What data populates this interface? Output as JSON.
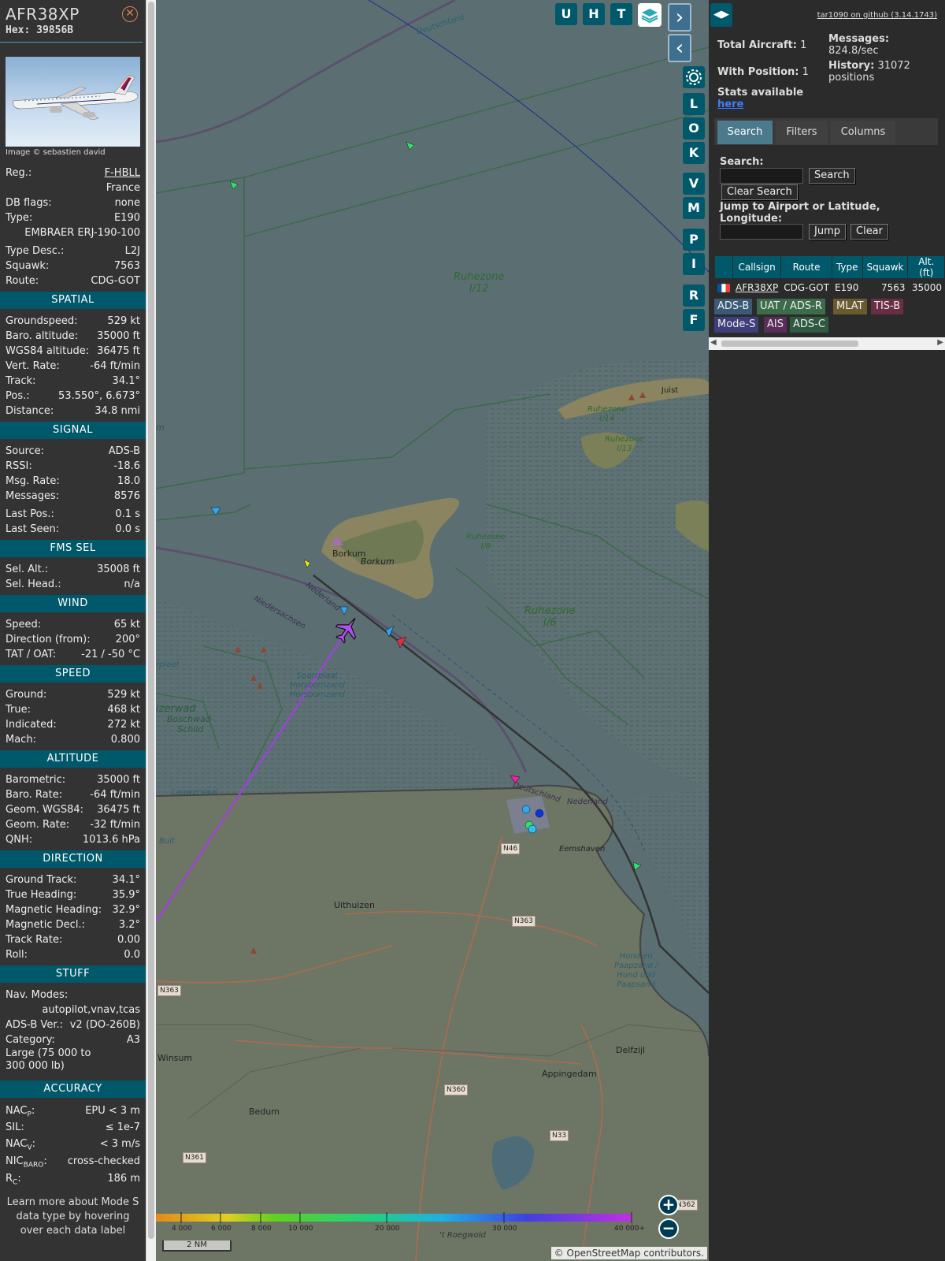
{
  "aircraft": {
    "callsign": "AFR38XP",
    "hex_label": "Hex:",
    "hex_value": "39856B",
    "close_icon": "close-circle-icon",
    "photo_credit": "Image © sebastien david",
    "reg_label": "Reg.:",
    "reg_value": "F-HBLL",
    "country": "France",
    "dbflags_label": "DB flags:",
    "dbflags_value": "none",
    "type_label": "Type:",
    "type_value": "E190",
    "type_full": "EMBRAER ERJ-190-100",
    "typedesc_label": "Type Desc.:",
    "typedesc_value": "L2J",
    "squawk_label": "Squawk:",
    "squawk_value": "7563",
    "route_label": "Route:",
    "route_value": "CDG-GOT"
  },
  "sections": {
    "spatial": {
      "title": "SPATIAL",
      "rows": [
        {
          "label": "Groundspeed:",
          "value": "529 kt"
        },
        {
          "label": "Baro. altitude:",
          "value": "35000 ft"
        },
        {
          "label": "WGS84 altitude:",
          "value": "36475 ft"
        },
        {
          "label": "Vert. Rate:",
          "value": "-64 ft/min"
        },
        {
          "label": "Track:",
          "value": "34.1°"
        },
        {
          "label": "Pos.:",
          "value": "53.550°, 6.673°"
        },
        {
          "label": "Distance:",
          "value": "34.8 nmi"
        }
      ]
    },
    "signal": {
      "title": "SIGNAL",
      "rows": [
        {
          "label": "Source:",
          "value": "ADS-B"
        },
        {
          "label": "RSSI:",
          "value": "-18.6"
        },
        {
          "label": "Msg. Rate:",
          "value": "18.0"
        },
        {
          "label": "Messages:",
          "value": "8576"
        }
      ],
      "rows2": [
        {
          "label": "Last Pos.:",
          "value": "0.1 s"
        },
        {
          "label": "Last Seen:",
          "value": "0.0 s"
        }
      ]
    },
    "fms": {
      "title": "FMS SEL",
      "rows": [
        {
          "label": "Sel. Alt.:",
          "value": "35008 ft"
        },
        {
          "label": "Sel. Head.:",
          "value": "n/a"
        }
      ]
    },
    "wind": {
      "title": "WIND",
      "rows": [
        {
          "label": "Speed:",
          "value": "65 kt"
        },
        {
          "label": "Direction (from):",
          "value": "200°"
        },
        {
          "label": "TAT / OAT:",
          "value": "-21 / -50 °C"
        }
      ]
    },
    "speed": {
      "title": "SPEED",
      "rows": [
        {
          "label": "Ground:",
          "value": "529 kt"
        },
        {
          "label": "True:",
          "value": "468 kt"
        },
        {
          "label": "Indicated:",
          "value": "272 kt"
        },
        {
          "label": "Mach:",
          "value": "0.800"
        }
      ]
    },
    "altitude": {
      "title": "ALTITUDE",
      "rows": [
        {
          "label": "Barometric:",
          "value": "35000 ft"
        },
        {
          "label": "Baro. Rate:",
          "value": "-64 ft/min"
        },
        {
          "label": "Geom. WGS84:",
          "value": "36475 ft"
        },
        {
          "label": "Geom. Rate:",
          "value": "-32 ft/min"
        },
        {
          "label": "QNH:",
          "value": "1013.6 hPa"
        }
      ]
    },
    "direction": {
      "title": "DIRECTION",
      "rows": [
        {
          "label": "Ground Track:",
          "value": "34.1°"
        },
        {
          "label": "True Heading:",
          "value": "35.9°"
        },
        {
          "label": "Magnetic Heading:",
          "value": "32.9°"
        },
        {
          "label": "Magnetic Decl.:",
          "value": "3.2°"
        },
        {
          "label": "Track Rate:",
          "value": "0.00"
        },
        {
          "label": "Roll:",
          "value": "0.0"
        }
      ]
    },
    "stuff": {
      "title": "STUFF",
      "navmodes_label": "Nav. Modes:",
      "navmodes_value": "autopilot,vnav,tcas",
      "adsbver_label": "ADS-B Ver.:",
      "adsbver_value": "v2 (DO-260B)",
      "category_label": "Category:",
      "category_value": "A3",
      "category_desc_1": "Large (75 000 to",
      "category_desc_2": "300 000 lb)"
    },
    "accuracy": {
      "title": "ACCURACY",
      "nacp_label": "NAC",
      "nacp_sub": "P",
      "nacp_value": "EPU < 3 m",
      "sil_label": "SIL:",
      "sil_value": "≤ 1e-7",
      "nacv_label": "NAC",
      "nacv_sub": "V",
      "nacv_value": "< 3 m/s",
      "nic_label": "NIC",
      "nic_sub": "BARO",
      "nic_value": "cross-checked",
      "rc_label": "R",
      "rc_sub": "C",
      "rc_value": "186 m"
    },
    "footer": "Learn more about Mode S data type by hovering over each data label"
  },
  "map": {
    "labels": {
      "deutschland_top": "Deutschland",
      "ruhezone_i12": "Ruhezone\nI/12",
      "ruhezone_i14": "Ruhezone\nI/14",
      "ruhezone_i13": "Ruhezone\nI/13",
      "ruhezone_i8": "Ruhezone\nI/8",
      "ruhezone_i6": "Ruhezone\nI/6",
      "juist": "Juist",
      "borkum_town": "Borkum",
      "borkum_island": "Borkum",
      "nederland_1": "Nederland",
      "niedersachsen": "Niedersachsen",
      "sparrplaat": "Sparrplaat\nHorsbornzand\nHorsbornzand",
      "zierwad": "izerwad",
      "boschwad": "Boschwad-\nSchild",
      "lauwerswal": "Lauwerswal",
      "bult": "Bult",
      "plaat": "rplaat",
      "m_edge": "m",
      "deutschland_bottom": "Deutschland",
      "nederland_bottom": "Nederland",
      "eemshaven": "Eemshaven",
      "uithuizen": "Uithuizen",
      "winsum": "Winsum",
      "bedum": "Bedum",
      "appingedam": "Appingedam",
      "delfzijl": "Delfzijl",
      "paapzand": "Hond en\nPaapzand /\nHund und\nPaapsand",
      "roegwold": "'t Roegwold"
    },
    "roads": [
      "N46",
      "N363",
      "N363",
      "N360",
      "N33",
      "N361",
      "N362"
    ],
    "buttons": {
      "u": "U",
      "h": "H",
      "t": "T",
      "l": "L",
      "o": "O",
      "k": "K",
      "v": "V",
      "m": "M",
      "p": "P",
      "i": "I",
      "r": "R",
      "f": "F"
    },
    "icons": {
      "layers": "layers-icon",
      "next": "chevron-right-icon",
      "prev": "chevron-left-icon",
      "settings": "gear-icon",
      "zoom_in": "plus-icon",
      "zoom_out": "minus-icon"
    },
    "legend_ticks": [
      "4 000",
      "6 000",
      "8 000",
      "10 000",
      "20 000",
      "30 000",
      "40 000+"
    ],
    "scale": "2 NM",
    "attribution_prefix": "© ",
    "attribution_link": "OpenStreetMap",
    "attribution_suffix": " contributors."
  },
  "sidebar": {
    "toggle_icon": "expand-arrows-icon",
    "version": "tar1090 on github (3.14.1743)",
    "total_aircraft_label": "Total Aircraft:",
    "total_aircraft_value": "1",
    "with_position_label": "With Position:",
    "with_position_value": "1",
    "messages_label": "Messages:",
    "messages_value": "824.8/sec",
    "history_label": "History:",
    "history_value": "31072",
    "history_unit": "positions",
    "stats_text": "Stats available",
    "stats_link": "here",
    "tabs": [
      "Search",
      "Filters",
      "Columns"
    ],
    "search_label": "Search:",
    "search_value": "",
    "search_button": "Search",
    "clear_search_button": "Clear Search",
    "jump_label": "Jump to Airport or Latitude, Longitude:",
    "jump_value": "",
    "jump_button": "Jump",
    "clear_button": "Clear",
    "table": {
      "headers": [
        "",
        "Callsign",
        "Route",
        "Type",
        "Squawk",
        "Alt. (ft)"
      ],
      "rows": [
        {
          "flag": "fr-flag-icon",
          "callsign": "AFR38XP",
          "route": "CDG-GOT",
          "type": "E190",
          "squawk": "7563",
          "alt": "35000"
        }
      ]
    },
    "sources": [
      "ADS-B",
      "UAT / ADS-R",
      "MLAT",
      "TIS-B",
      "Mode-S",
      "AIS",
      "ADS-C"
    ],
    "colors": {
      "accent": "#00596b",
      "adsb": "#3b5a78",
      "uat": "#3c6c4a",
      "mlat": "#6a5a30",
      "tisb": "#6a2e44",
      "modes": "#3e3f7a",
      "ais": "#5a2e5a",
      "adsc": "#2e5a40"
    }
  }
}
